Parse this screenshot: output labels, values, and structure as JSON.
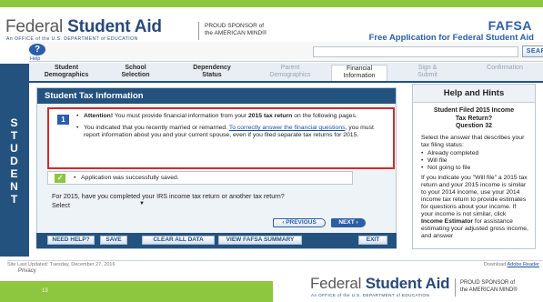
{
  "header": {
    "logo_light": "Federal",
    "logo_bold": "Student Aid",
    "logo_sub": "An OFFICE of the U.S. DEPARTMENT of EDUCATION",
    "sponsor_line1": "PROUD SPONSOR of",
    "sponsor_line2": "the AMERICAN MIND®",
    "fafsa_logo": "FAFSA",
    "fafsa_tagline": "Free Application for Federal Student Aid"
  },
  "toolbar": {
    "help_label": "Help",
    "search_placeholder": "",
    "search_button": "SEARCH"
  },
  "side_label": [
    "S",
    "T",
    "U",
    "D",
    "E",
    "N",
    "T"
  ],
  "tabs": [
    {
      "line1": "Student",
      "line2": "Demographics"
    },
    {
      "line1": "School",
      "line2": "Selection"
    },
    {
      "line1": "Dependency",
      "line2": "Status"
    },
    {
      "line1": "Parent",
      "line2": "Demographics"
    },
    {
      "line1": "Financial",
      "line2": "Information"
    },
    {
      "line1": "Sign &",
      "line2": "Submit"
    },
    {
      "line1": "Confirmation",
      "line2": ""
    }
  ],
  "main": {
    "title": "Student Tax Information",
    "info_number": "1",
    "attention_bold": "Attention!",
    "attention_text": " You must provide financial information from your ",
    "attention_year": "2015 tax return",
    "attention_end": " on the following pages.",
    "married_text": "You indicated that you recently married or remarried. ",
    "married_link": "To correctly answer the financial questions",
    "married_end": ", you must report information about you and your current spouse, even if you filed separate tax returns for 2015.",
    "saved_text": "Application was successfully saved.",
    "question": "For 2015, have you completed your IRS income tax return or another tax return?",
    "select_value": "Select",
    "previous_button": "PREVIOUS",
    "next_button": "NEXT"
  },
  "bottom_buttons": {
    "need_help": "NEED HELP?",
    "save": "SAVE",
    "clear_all": "CLEAR ALL DATA",
    "view_summary": "VIEW FAFSA SUMMARY",
    "exit": "EXIT"
  },
  "hints": {
    "title": "Help and Hints",
    "subtitle_line1": "Student Filed 2015 Income",
    "subtitle_line2": "Tax Return?",
    "subtitle_line3": "Question 32",
    "intro": "Select the answer that describes your tax filing status:",
    "options": [
      "Already completed",
      "Will file",
      "Not going to file"
    ],
    "detail_start": "If you indicate you \"Will file\" a 2015 tax return and your 2015 income is similar to your 2014 income, use your 2014 income tax return to provide estimates for questions about your income. If your income is not similar, click ",
    "detail_bold": "Income Estimator",
    "detail_end": " for assistance estimating your adjusted gross income, and answer"
  },
  "footer": {
    "updated": "Site Last Updated: Tuesday, December 27, 2016",
    "privacy": "Privacy",
    "download_text": "Download ",
    "download_link": "Adobe Reader",
    "slide_number": "13"
  }
}
